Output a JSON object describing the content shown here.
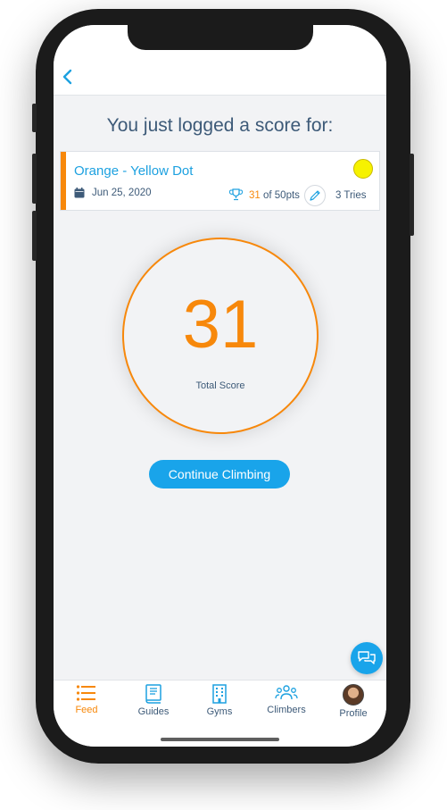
{
  "nav": {
    "back_icon": "chevron-left-icon"
  },
  "heading": "You just logged a score for:",
  "route_card": {
    "name": "Orange - Yellow Dot",
    "date": "Jun 25, 2020",
    "score": "31",
    "score_suffix": " of 50pts",
    "tries": "3 Tries",
    "stripe_color": "#f7880b",
    "dot_color": "#f6f200"
  },
  "score": {
    "value": "31",
    "label": "Total Score"
  },
  "continue_button": "Continue Climbing",
  "tabs": [
    {
      "label": "Feed",
      "icon": "list-icon",
      "active": true
    },
    {
      "label": "Guides",
      "icon": "book-icon",
      "active": false
    },
    {
      "label": "Gyms",
      "icon": "building-icon",
      "active": false
    },
    {
      "label": "Climbers",
      "icon": "people-icon",
      "active": false
    },
    {
      "label": "Profile",
      "icon": "avatar",
      "active": false
    }
  ],
  "colors": {
    "accent": "#f7880b",
    "primary": "#19a4ea",
    "text": "#3d5a78"
  }
}
